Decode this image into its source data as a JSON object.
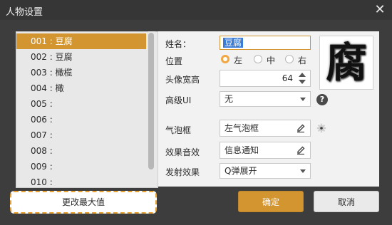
{
  "window": {
    "title": "人物设置"
  },
  "list": {
    "items": [
      {
        "label": "001 : 豆腐",
        "selected": true
      },
      {
        "label": "002 : 豆腐",
        "selected": false
      },
      {
        "label": "003 : 橄榄",
        "selected": false
      },
      {
        "label": "004 : 橄",
        "selected": false
      },
      {
        "label": "005 :",
        "selected": false
      },
      {
        "label": "006 :",
        "selected": false
      },
      {
        "label": "007 :",
        "selected": false
      },
      {
        "label": "008 :",
        "selected": false
      },
      {
        "label": "009 :",
        "selected": false
      },
      {
        "label": "010 :",
        "selected": false
      }
    ]
  },
  "buttons": {
    "max_label": "更改最大值",
    "ok_label": "确定",
    "cancel_label": "取消"
  },
  "form": {
    "name_label": "姓名：",
    "name_value": "豆腐",
    "position_label": "位置",
    "position_options": [
      "左",
      "中",
      "右"
    ],
    "position_selected": "左",
    "avatar_width_label": "头像宽高",
    "avatar_width_value": "64",
    "advanced_ui_label": "高级UI",
    "advanced_ui_value": "无",
    "bubble_label": "气泡框",
    "bubble_value": "左气泡框",
    "sfx_label": "效果音效",
    "sfx_value": "信息通知",
    "launch_label": "发射效果",
    "launch_value": "Q弹展开"
  },
  "avatar": {
    "glyph": "腐"
  },
  "colors": {
    "accent": "#d3952f",
    "radio_on": "#f2a742",
    "dashed_border": "#e8a233"
  },
  "icons": [
    "close-icon",
    "help-icon",
    "edit-icon",
    "gear-icon",
    "spinner-arrows-icon",
    "dropdown-caret-icon"
  ]
}
